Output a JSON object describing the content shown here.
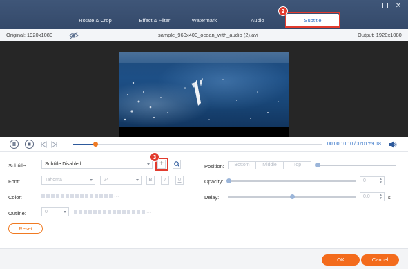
{
  "tabs": [
    {
      "label": "Rotate & Crop"
    },
    {
      "label": "Effect & Filter"
    },
    {
      "label": "Watermark"
    },
    {
      "label": "Audio"
    },
    {
      "label": "Subtitle"
    }
  ],
  "info": {
    "original": "Original: 1920x1080",
    "filename": "sample_960x400_ocean_with_audio (2).avi",
    "output": "Output: 1920x1080"
  },
  "player": {
    "progress": 0.09,
    "current_time": "00:00:10.10",
    "total_time": "/00:01:59.18"
  },
  "subtitle": {
    "label": "Subtitle:",
    "value": "Subtitle Disabled",
    "add_symbol": "+"
  },
  "font": {
    "label": "Font:",
    "family": "Tahoma",
    "size": "24",
    "bold": "B",
    "italic": "I",
    "underline": "U"
  },
  "color": {
    "label": "Color:",
    "more": "···"
  },
  "outline": {
    "label": "Outline:",
    "value": "0",
    "more": "···"
  },
  "position": {
    "label": "Position:",
    "options": [
      "Bottom",
      "Middle",
      "Top"
    ]
  },
  "opacity": {
    "label": "Opacity:",
    "value": "0"
  },
  "delay": {
    "label": "Delay:",
    "value": "0.0",
    "unit": "s"
  },
  "buttons": {
    "reset": "Reset",
    "ok": "OK",
    "cancel": "Cancel"
  },
  "annotations": {
    "marker_2": "2",
    "marker_3": "3"
  }
}
